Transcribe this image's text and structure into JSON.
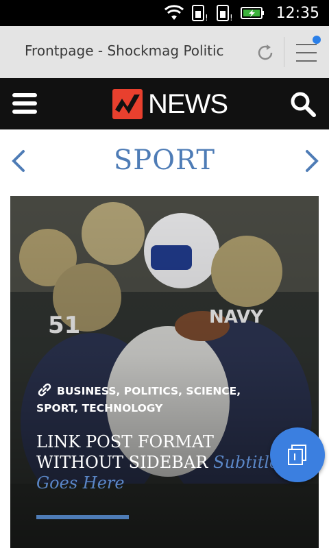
{
  "status_bar": {
    "time": "12:35",
    "icons": [
      "wifi-icon",
      "sim1-icon",
      "sim2-icon",
      "battery-charging-icon"
    ]
  },
  "browser": {
    "url_title": "Frontpage - Shockmag Politic",
    "icons": [
      "reload-icon",
      "menu-icon"
    ],
    "notification_color": "#2b7fe8"
  },
  "site_header": {
    "logo_text": "NEWS",
    "icons": [
      "hamburger-icon",
      "logo-mark-icon",
      "search-icon"
    ]
  },
  "section": {
    "title": "SPORT",
    "icons": [
      "chevron-left-icon",
      "chevron-right-icon"
    ]
  },
  "featured_post": {
    "categories": "BUSINESS, POLITICS, SCIENCE, SPORT, TECHNOLOGY",
    "title": "LINK POST FORMAT WITHOUT SIDEBAR",
    "subtitle": "Subtitle Goes Here",
    "icons": [
      "link-icon"
    ]
  },
  "fab": {
    "icon": "copy-pages-icon"
  },
  "colors": {
    "accent": "#4e7cb6",
    "header_bg": "#111111",
    "browser_bar_bg": "#e4e4e4",
    "fab": "#3b7fe0"
  }
}
